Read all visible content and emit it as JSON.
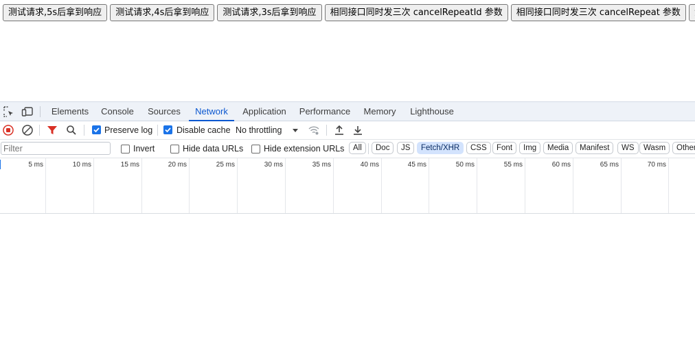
{
  "page": {
    "buttons": [
      "测试请求,5s后拿到响应",
      "测试请求,4s后拿到响应",
      "测试请求,3s后拿到响应",
      "相同接口同时发三次 cancelRepeatId 参数",
      "相同接口同时发三次 cancelRepeat 参数",
      "测"
    ]
  },
  "devtools": {
    "tabs": [
      "Elements",
      "Console",
      "Sources",
      "Network",
      "Application",
      "Performance",
      "Memory",
      "Lighthouse"
    ],
    "active_tab": "Network",
    "toolbar": {
      "preserve_log_label": "Preserve log",
      "preserve_log_checked": true,
      "disable_cache_label": "Disable cache",
      "disable_cache_checked": true,
      "throttling_value": "No throttling"
    },
    "filterbar": {
      "filter_placeholder": "Filter",
      "invert_label": "Invert",
      "hide_data_urls_label": "Hide data URLs",
      "hide_extension_urls_label": "Hide extension URLs",
      "type_filters": [
        "All",
        "Doc",
        "JS",
        "Fetch/XHR",
        "CSS",
        "Font",
        "Img",
        "Media",
        "Manifest",
        "WS",
        "Wasm",
        "Other"
      ],
      "active_type_filter": "Fetch/XHR"
    },
    "timeline_ticks": [
      "5 ms",
      "10 ms",
      "15 ms",
      "20 ms",
      "25 ms",
      "30 ms",
      "35 ms",
      "40 ms",
      "45 ms",
      "50 ms",
      "55 ms",
      "60 ms",
      "65 ms",
      "70 ms"
    ]
  },
  "colors": {
    "accent": "#0b57d0",
    "record_red": "#d93025",
    "filter_red": "#d93025",
    "checkbox_blue": "#1a73e8",
    "chip_active_bg": "#d3e3fd"
  }
}
